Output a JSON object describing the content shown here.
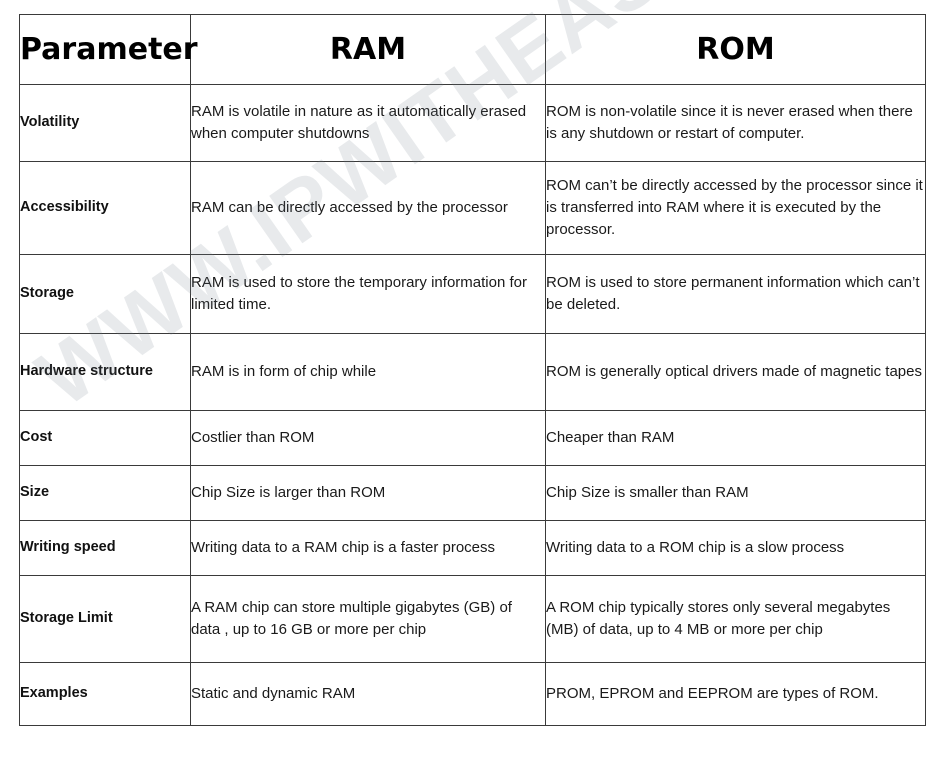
{
  "table": {
    "headers": [
      {
        "label": "Parameter",
        "name": "parameter"
      },
      {
        "label": "RAM",
        "name": "ram"
      },
      {
        "label": "ROM",
        "name": "rom"
      }
    ],
    "header_bg_color": "#00AEEF",
    "border_color": "#3a3a3a",
    "rows": [
      {
        "parameter": "Volatility",
        "ram": "RAM is volatile in nature as it automatically erased when computer shutdowns",
        "rom": "ROM is non-volatile since it is never erased when there is any shutdown or restart of computer."
      },
      {
        "parameter": "Accessibility",
        "ram": "RAM can be directly accessed by the processor",
        "rom": "ROM can’t be directly accessed by the processor since it is transferred into RAM where it is executed by the processor."
      },
      {
        "parameter": "Storage",
        "ram": "RAM is used to store the temporary information for limited time.",
        "rom": "ROM is used to store permanent information which can’t be deleted."
      },
      {
        "parameter": "Hardware structure",
        "ram": "RAM is in form of chip while",
        "rom": "ROM is generally optical drivers made of magnetic tapes"
      },
      {
        "parameter": "Cost",
        "ram": "Costlier than ROM",
        "rom": "Cheaper than RAM"
      },
      {
        "parameter": "Size",
        "ram": "Chip Size is larger than ROM",
        "rom": "Chip Size is smaller than RAM"
      },
      {
        "parameter": "Writing speed",
        "ram": "Writing data to a RAM chip is a faster process",
        "rom": "Writing data to a ROM chip is a slow process"
      },
      {
        "parameter": "Storage Limit",
        "ram": "A RAM chip can store multiple gigabytes (GB) of data , up to 16 GB or more per chip",
        "rom": "A ROM chip typically stores only several megabytes (MB) of data, up to 4 MB or more per chip"
      },
      {
        "parameter": "Examples",
        "ram": "Static and dynamic RAM",
        "rom": "PROM, EPROM and EEPROM are types of ROM."
      }
    ]
  },
  "watermark": {
    "text": "WWW.IPWITHEASE.COM",
    "color": "#7882914 "
  }
}
